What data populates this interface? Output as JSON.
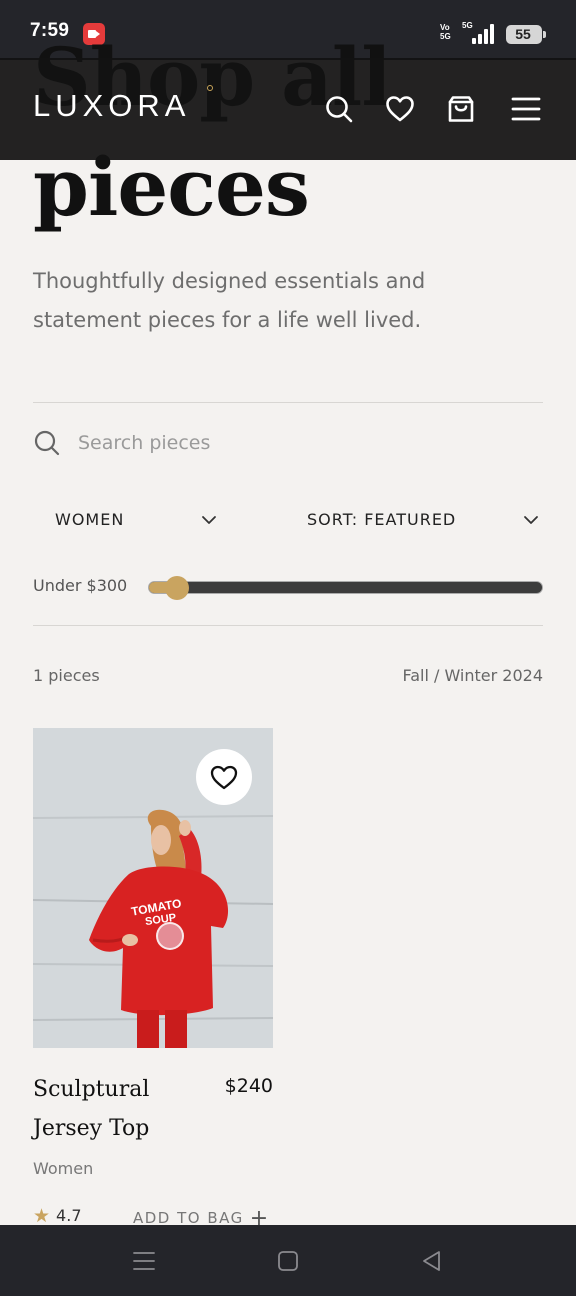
{
  "status_bar": {
    "time": "7:59",
    "volte": "Vo\n5G",
    "network": "5G",
    "battery": "55",
    "icons": [
      "screen-record-icon",
      "signal-icon",
      "battery-icon"
    ]
  },
  "hero": {
    "title_line1": "Shop all",
    "title_line2": "pieces",
    "subtitle": "Thoughtfully designed essentials and statement pieces for a life well lived."
  },
  "header": {
    "brand": "LUXORA",
    "icons": [
      "search-icon",
      "heart-icon",
      "bag-icon",
      "menu-icon"
    ]
  },
  "search": {
    "placeholder": "Search pieces",
    "value": ""
  },
  "filters": {
    "category": "WOMEN",
    "sort": "SORT: FEATURED"
  },
  "price_filter": {
    "label": "Under $300",
    "level_fraction": 0.07
  },
  "results": {
    "count": "1 pieces",
    "season": "Fall / Winter 2024"
  },
  "products": [
    {
      "name": "Sculptural Jersey Top",
      "price": "$240",
      "category": "Women",
      "rating": "4.7",
      "add_label": "ADD TO BAG",
      "add_symbol": "+"
    }
  ],
  "colors": {
    "accent": "#c9a460",
    "header_bg": "#121212",
    "page_bg": "#f4f2f0"
  }
}
